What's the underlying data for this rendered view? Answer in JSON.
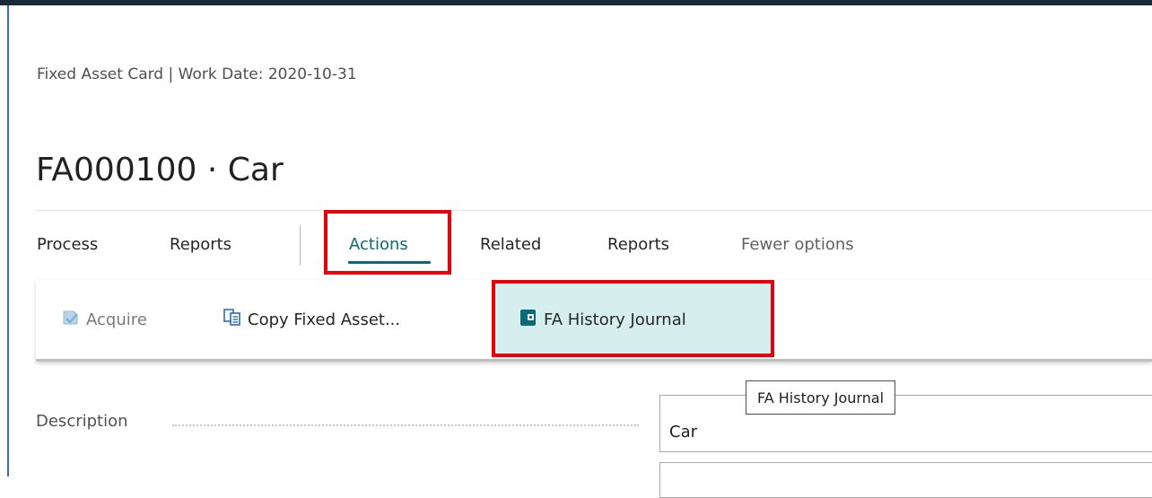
{
  "breadcrumb": "Fixed Asset Card | Work Date: 2020-10-31",
  "page_title": "FA000100 · Car",
  "menu": {
    "promoted": [
      "Process",
      "Reports"
    ],
    "actions": "Actions",
    "related": "Related",
    "reports": "Reports",
    "fewer_options": "Fewer options",
    "active": "Actions"
  },
  "action_bar": {
    "acquire": {
      "label": "Acquire",
      "icon": "acquire-icon",
      "enabled": false
    },
    "copy_fixed_asset": {
      "label": "Copy Fixed Asset...",
      "icon": "copy-icon"
    },
    "fa_history_journal": {
      "label": "FA History Journal",
      "icon": "journal-icon",
      "selected": true
    }
  },
  "fields": {
    "description": {
      "label": "Description",
      "value": "Car"
    }
  },
  "tooltip": "FA History Journal",
  "colors": {
    "accent": "#0b6a75",
    "highlight_red": "#e8000b",
    "selected_bg": "#d7eeee",
    "top_bar": "#1b2a38"
  }
}
